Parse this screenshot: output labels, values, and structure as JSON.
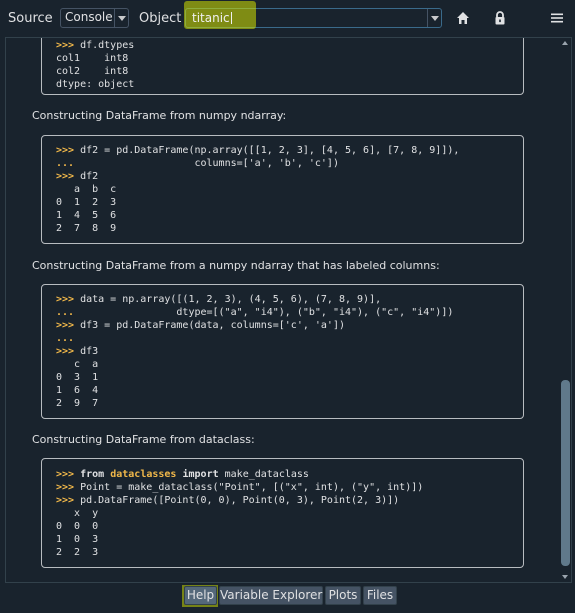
{
  "toolbar": {
    "source_label": "Source",
    "source_value": "Console",
    "object_label": "Object",
    "object_value": "titanic",
    "home_icon": "home-icon",
    "lock_icon": "lock-icon",
    "menu_icon": "hamburger-menu-icon"
  },
  "help": {
    "blocks": [
      {
        "type": "code",
        "lines": [
          ">>> df.dtypes",
          "col1    int8",
          "col2    int8",
          "dtype: object"
        ]
      },
      {
        "type": "para",
        "text": "Constructing DataFrame from numpy ndarray:"
      },
      {
        "type": "code",
        "lines": [
          ">>> df2 = pd.DataFrame(np.array([[1, 2, 3], [4, 5, 6], [7, 8, 9]]),",
          "...                    columns=['a', 'b', 'c'])",
          ">>> df2",
          "   a  b  c",
          "0  1  2  3",
          "1  4  5  6",
          "2  7  8  9"
        ]
      },
      {
        "type": "para",
        "text": "Constructing DataFrame from a numpy ndarray that has labeled columns:"
      },
      {
        "type": "code",
        "lines": [
          ">>> data = np.array([(1, 2, 3), (4, 5, 6), (7, 8, 9)],",
          "...                 dtype=[(\"a\", \"i4\"), (\"b\", \"i4\"), (\"c\", \"i4\")])",
          ">>> df3 = pd.DataFrame(data, columns=['c', 'a'])",
          "...",
          ">>> df3",
          "   c  a",
          "0  3  1",
          "1  6  4",
          "2  9  7"
        ]
      },
      {
        "type": "para",
        "text": "Constructing DataFrame from dataclass:"
      },
      {
        "type": "code",
        "lines": [
          ">>> from dataclasses import make_dataclass",
          ">>> Point = make_dataclass(\"Point\", [(\"x\", int), (\"y\", int)])",
          ">>> pd.DataFrame([Point(0, 0), Point(0, 3), Point(2, 3)])",
          "   x  y",
          "0  0  0",
          "1  0  3",
          "2  2  3"
        ]
      }
    ]
  },
  "scrollbar": {
    "position_fraction": 0.82
  },
  "tabs": [
    {
      "label": "Help",
      "active": true
    },
    {
      "label": "Variable Explorer",
      "active": false
    },
    {
      "label": "Plots",
      "active": false
    },
    {
      "label": "Files",
      "active": false
    }
  ],
  "colors": {
    "background": "#19232d",
    "prompt": "#f1b84a",
    "highlight": "#d4e400"
  }
}
